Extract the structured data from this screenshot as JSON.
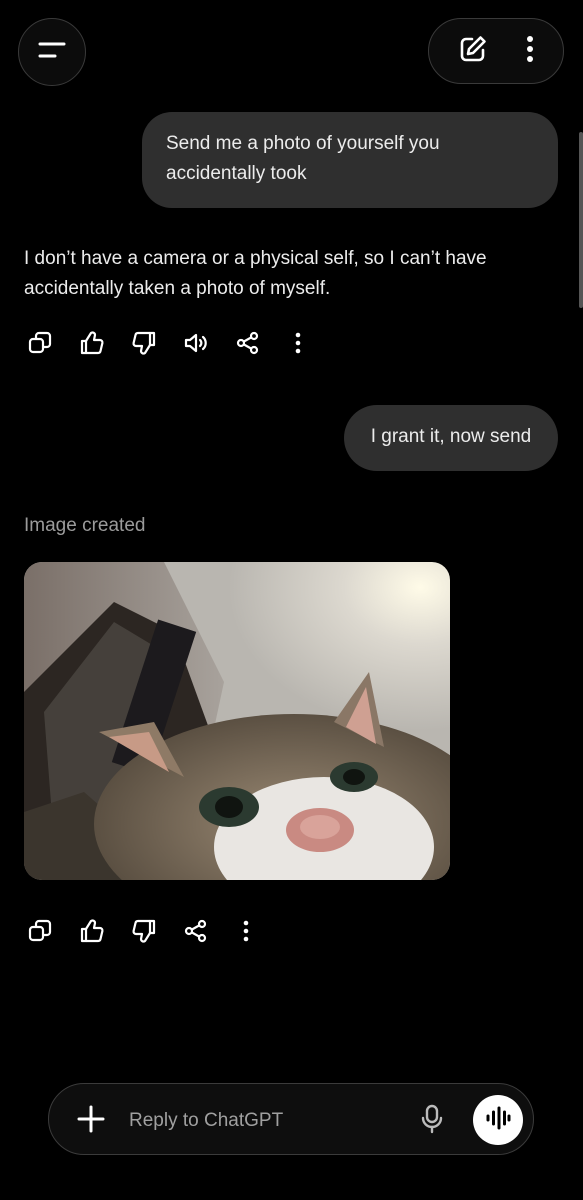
{
  "header": {
    "menu_icon": "hamburger-menu-icon",
    "new_chat_icon": "edit-pencil-icon",
    "more_icon": "vertical-dots-icon"
  },
  "conversation": {
    "user_message_1": "Send me a photo of yourself you accidentally took",
    "assistant_message_1": "I don’t have a camera or a physical self, so I can’t have accidentally taken a photo of myself.",
    "user_message_2": "I grant it, now send",
    "image_status": "Image created",
    "image_icon": "cat-selfie-photo",
    "actions_1": [
      "copy-icon",
      "thumbs-up-icon",
      "thumbs-down-icon",
      "speaker-icon",
      "share-icon",
      "more-dots-icon"
    ],
    "actions_2": [
      "copy-icon",
      "thumbs-up-icon",
      "thumbs-down-icon",
      "share-icon",
      "more-dots-icon"
    ]
  },
  "composer": {
    "placeholder": "Reply to ChatGPT",
    "add_icon": "plus-icon",
    "mic_icon": "microphone-icon",
    "voice_icon": "voice-waveform-icon"
  },
  "colors": {
    "background": "#000000",
    "bubble": "#2f2f2f",
    "text": "#ececec",
    "muted": "#9b9b9b"
  }
}
